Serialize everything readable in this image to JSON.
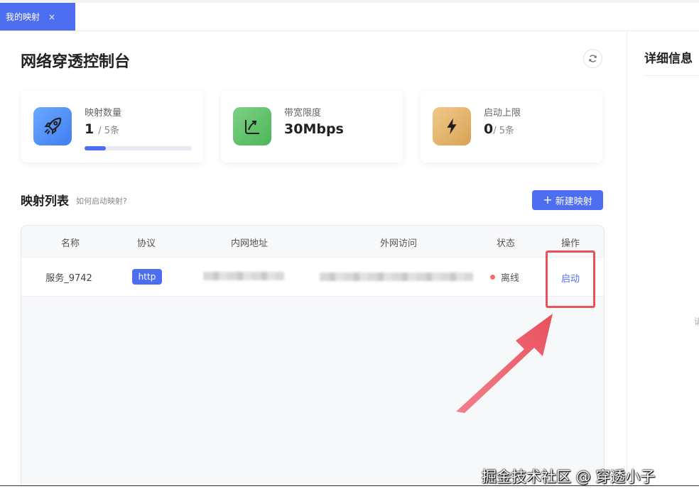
{
  "tab": {
    "label": "我的映射",
    "close": "×"
  },
  "page": {
    "title": "网络穿透控制台"
  },
  "side": {
    "title": "详细信息",
    "hint": "请"
  },
  "cards": [
    {
      "label": "映射数量",
      "value": "1",
      "suffix": "/ 5条",
      "progress": 0.2,
      "icon": "rocket-icon",
      "icon_bg": "#4a8ff5"
    },
    {
      "label": "带宽限度",
      "value": "30Mbps",
      "suffix": "",
      "icon": "speed-chart-icon",
      "icon_bg": "#5cc168"
    },
    {
      "label": "启动上限",
      "value": "0",
      "suffix": "/ 5条",
      "icon": "lightning-icon",
      "icon_bg": "#e0b069"
    }
  ],
  "section": {
    "title": "映射列表",
    "help": "如何启动映射?",
    "new_button": "新建映射",
    "new_button_icon": "+"
  },
  "table": {
    "headers": [
      "名称",
      "协议",
      "内网地址",
      "外网访问",
      "状态",
      "操作"
    ],
    "rows": [
      {
        "name": "服务_9742",
        "protocol": "http",
        "status": "离线",
        "action": "启动"
      }
    ]
  },
  "watermark": "掘金技术社区 @ 穿透小子",
  "colors": {
    "accent": "#4e6ef2",
    "offline": "#f56c6c",
    "highlight": "#e8505b"
  }
}
